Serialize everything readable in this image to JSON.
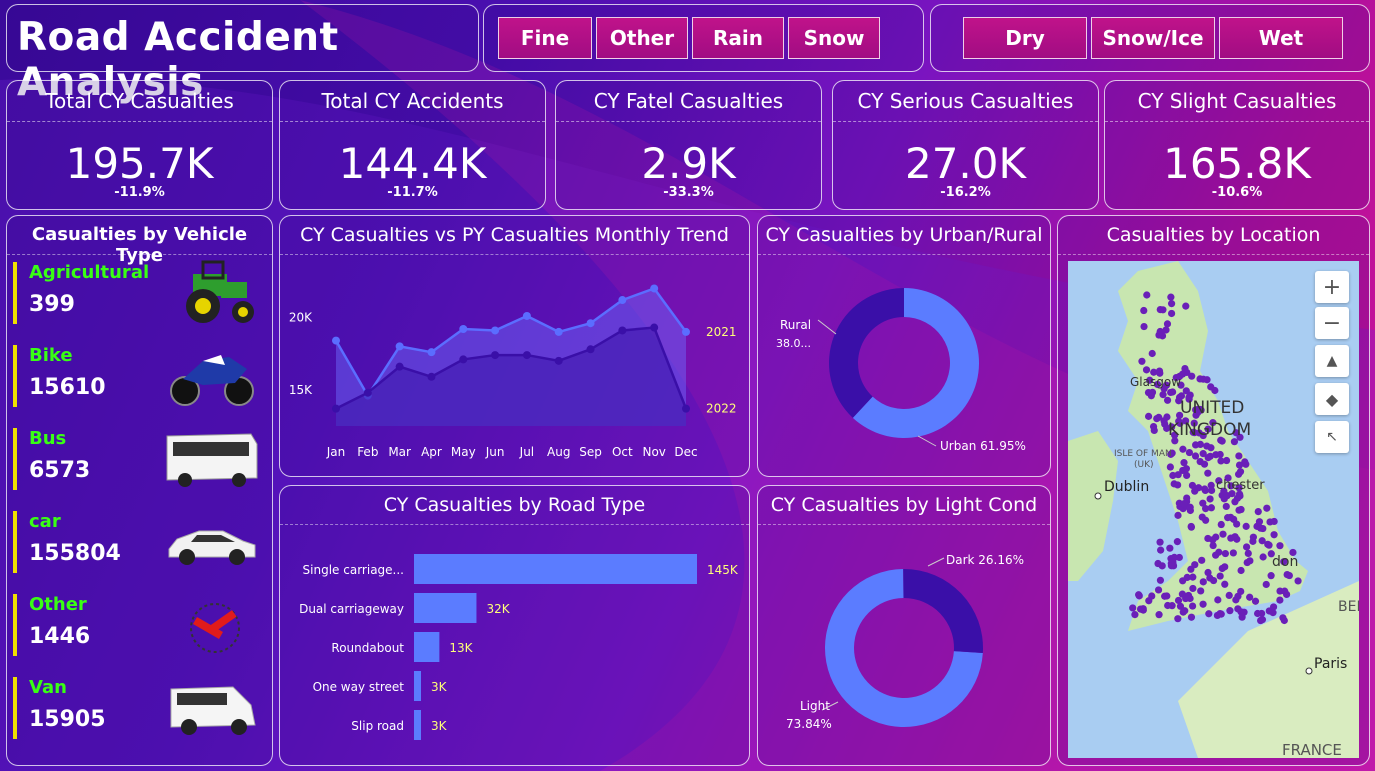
{
  "title": "Road Accident Analysis",
  "weather_slicer": [
    "Fine",
    "Other",
    "Rain",
    "Snow"
  ],
  "surface_slicer": [
    "Dry",
    "Snow/Ice",
    "Wet"
  ],
  "kpis": [
    {
      "title": "Total CY Casualties",
      "value": "195.7K",
      "delta": "-11.9%"
    },
    {
      "title": "Total CY Accidents",
      "value": "144.4K",
      "delta": "-11.7%"
    },
    {
      "title": "CY Fatel Casualties",
      "value": "2.9K",
      "delta": "-33.3%"
    },
    {
      "title": "CY Serious Casualties",
      "value": "27.0K",
      "delta": "-16.2%"
    },
    {
      "title": "CY Slight Casualties",
      "value": "165.8K",
      "delta": "-10.6%"
    }
  ],
  "vehicles": {
    "title": "Casualties by Vehicle Type",
    "items": [
      {
        "name": "Agricultural",
        "value": "399",
        "icon": "tractor-icon"
      },
      {
        "name": "Bike",
        "value": "15610",
        "icon": "motorbike-icon"
      },
      {
        "name": "Bus",
        "value": "6573",
        "icon": "bus-icon"
      },
      {
        "name": "car",
        "value": "155804",
        "icon": "car-icon"
      },
      {
        "name": "Other",
        "value": "1446",
        "icon": "other-vehicle-icon"
      },
      {
        "name": "Van",
        "value": "15905",
        "icon": "van-icon"
      }
    ]
  },
  "map": {
    "title": "Casualties by Location",
    "labels": [
      "UNITED",
      "KINGDOM",
      "ISLE OF MAN",
      "(UK)",
      "Dublin",
      "Paris",
      "FRANCE",
      "BEL",
      "chester",
      "don",
      "Glasgow"
    ],
    "controls": [
      "plus-icon",
      "minus-icon",
      "tilt-icon",
      "compass-icon",
      "select-icon"
    ]
  },
  "colors": {
    "accent": "#5b7cff",
    "dark": "#3a0fa8",
    "label_yellow": "#ffff7a",
    "veh_name": "#39ff14"
  },
  "chart_data": [
    {
      "type": "area",
      "title": "CY Casualties vs PY Casualties Monthly Trend",
      "categories": [
        "Jan",
        "Feb",
        "Mar",
        "Apr",
        "May",
        "Jun",
        "Jul",
        "Aug",
        "Sep",
        "Oct",
        "Nov",
        "Dec"
      ],
      "series": [
        {
          "name": "2021",
          "values": [
            18400,
            14600,
            18000,
            17600,
            19200,
            19100,
            20100,
            19000,
            19600,
            21200,
            22000,
            19000
          ]
        },
        {
          "name": "2022",
          "values": [
            13700,
            14800,
            16600,
            15900,
            17100,
            17400,
            17400,
            17000,
            17800,
            19100,
            19300,
            13700
          ]
        }
      ],
      "y_ticks": [
        "15K",
        "20K"
      ],
      "y_tick_values": [
        15000,
        20000
      ],
      "ylim": [
        12500,
        23000
      ]
    },
    {
      "type": "pie",
      "title": "CY Casualties by Urban/Rural",
      "labels": [
        "Urban",
        "Rural"
      ],
      "values": [
        61.95,
        38.05
      ],
      "display_labels": [
        "Urban 61.95%",
        "Rural",
        "38.0..."
      ]
    },
    {
      "type": "bar",
      "title": "CY Casualties by Road Type",
      "categories": [
        "Single carriage...",
        "Dual carriageway",
        "Roundabout",
        "One way street",
        "Slip road"
      ],
      "values": [
        145,
        32,
        13,
        3,
        3
      ],
      "data_labels": [
        "145K",
        "32K",
        "13K",
        "3K",
        "3K"
      ]
    },
    {
      "type": "pie",
      "title": "CY Casualties by Light Cond",
      "labels": [
        "Light",
        "Dark"
      ],
      "values": [
        73.84,
        26.16
      ],
      "display_labels": [
        "Dark 26.16%",
        "Light",
        "73.84%"
      ]
    }
  ]
}
